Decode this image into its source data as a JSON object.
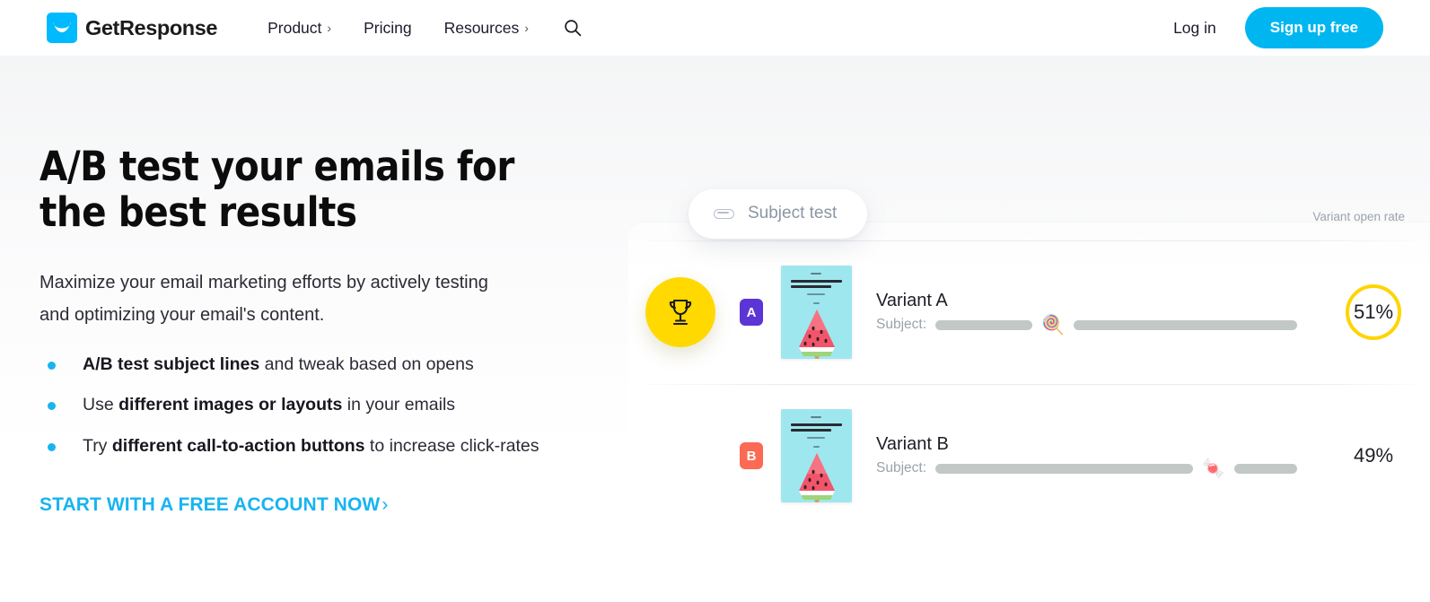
{
  "header": {
    "logo": {
      "text": "GetResponse",
      "icon": "envelope-logo-icon",
      "color": "#00baff"
    },
    "nav": [
      {
        "label": "Product",
        "caret": "›",
        "has_caret": true
      },
      {
        "label": "Pricing",
        "caret": "",
        "has_caret": false
      },
      {
        "label": "Resources",
        "caret": "›",
        "has_caret": true
      }
    ],
    "search_icon": "search-icon",
    "login_label": "Log in",
    "signup_label": "Sign up free",
    "signup_color": "#00b6f0"
  },
  "hero": {
    "title": "A/B test your emails for the best results",
    "subtitle": "Maximize your email marketing efforts by actively testing and optimizing your email's content.",
    "bullets": [
      {
        "bold_lead": "A/B test subject lines",
        "rest": " and tweak based on opens",
        "lead_first": true,
        "prefix": ""
      },
      {
        "prefix": "Use ",
        "bold_lead": "different images or layouts",
        "rest": " in your emails",
        "lead_first": false
      },
      {
        "prefix": "Try ",
        "bold_lead": "different call-to-action buttons",
        "rest": " to increase click-rates",
        "lead_first": false
      }
    ],
    "cta_label": "START WITH A FREE ACCOUNT NOW",
    "cta_chevron": "›",
    "cta_color": "#18b4f0",
    "bullet_color": "#18b4f0"
  },
  "illustration": {
    "subject_test_pill": {
      "label": "Subject test",
      "icon": "pill-toggle-icon"
    },
    "open_rate_header": "Variant open rate",
    "variants": [
      {
        "badge": "A",
        "badge_color": "#5b35d5",
        "name": "Variant A",
        "subject_label": "Subject:",
        "emoji": "🍭",
        "emoji_name": "lollipop-emoji",
        "rate": "51%",
        "winner": true,
        "ring_color": "#ffd400",
        "trophy_icon": "trophy-icon",
        "trophy_bg": "#ffd900",
        "card_thumb": "email-thumbnail-watermelon"
      },
      {
        "badge": "B",
        "badge_color": "#fb6a53",
        "name": "Variant B",
        "subject_label": "Subject:",
        "emoji": "🍬",
        "emoji_name": "candy-emoji",
        "rate": "49%",
        "winner": false,
        "ring_color": "",
        "trophy_icon": "",
        "trophy_bg": "",
        "card_thumb": "email-thumbnail-watermelon"
      }
    ]
  }
}
